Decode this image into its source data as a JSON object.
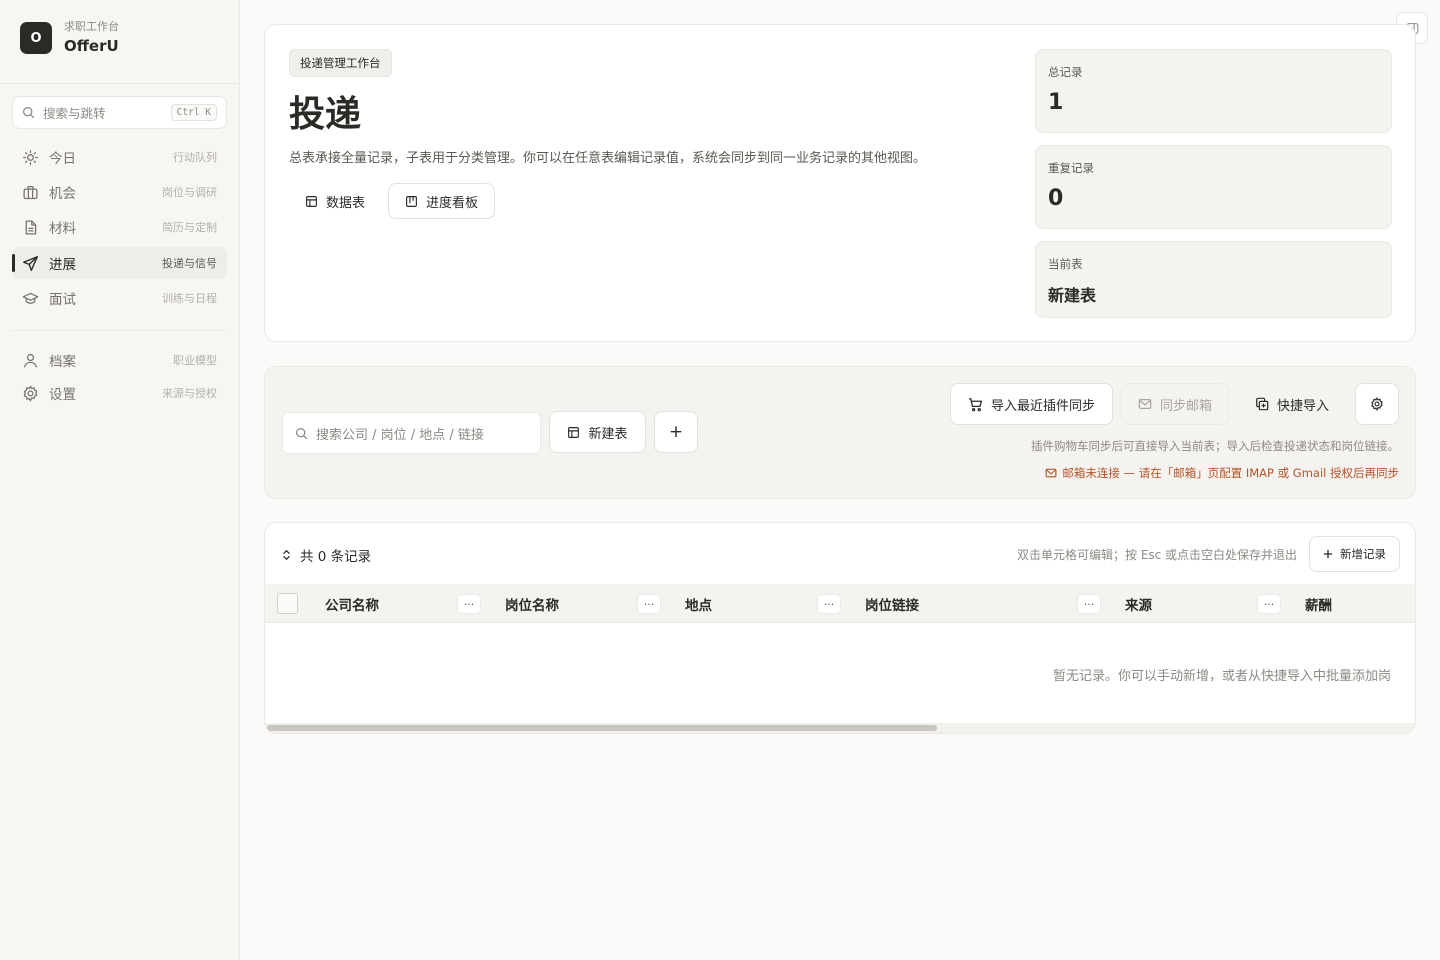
{
  "app": {
    "subtitle": "求职工作台",
    "name": "OfferU",
    "logo_letter": "O"
  },
  "sidebar": {
    "search": {
      "placeholder": "搜索与跳转",
      "shortcut": "Ctrl K"
    },
    "items": [
      {
        "label": "今日",
        "hint": "行动队列",
        "icon": "sun-icon",
        "active": false
      },
      {
        "label": "机会",
        "hint": "岗位与调研",
        "icon": "briefcase-icon",
        "active": false
      },
      {
        "label": "材料",
        "hint": "简历与定制",
        "icon": "document-icon",
        "active": false
      },
      {
        "label": "进展",
        "hint": "投递与信号",
        "icon": "send-icon",
        "active": true
      },
      {
        "label": "面试",
        "hint": "训练与日程",
        "icon": "graduation-cap-icon",
        "active": false
      }
    ],
    "bottom_items": [
      {
        "label": "档案",
        "hint": "职业模型",
        "icon": "user-icon"
      },
      {
        "label": "设置",
        "hint": "来源与授权",
        "icon": "gear-icon"
      }
    ]
  },
  "hero": {
    "badge": "投递管理工作台",
    "title": "投递",
    "description": "总表承接全量记录，子表用于分类管理。你可以在任意表编辑记录值，系统会同步到同一业务记录的其他视图。",
    "views": [
      {
        "label": "数据表",
        "icon": "table-icon"
      },
      {
        "label": "进度看板",
        "icon": "kanban-icon"
      }
    ],
    "stats": [
      {
        "label": "总记录",
        "value": "1"
      },
      {
        "label": "重复记录",
        "value": "0"
      },
      {
        "label": "当前表",
        "value": "新建表"
      }
    ]
  },
  "toolbar": {
    "search_placeholder": "搜索公司 / 岗位 / 地点 / 链接",
    "new_table_label": "新建表",
    "add_label": "+",
    "import_plugin_label": "导入最近插件同步",
    "sync_mail_label": "同步邮箱",
    "quick_import_label": "快捷导入",
    "hint": "插件购物车同步后可直接导入当前表；导入后检查投递状态和岗位链接。",
    "warning": "邮箱未连接 — 请在「邮箱」页配置 IMAP 或 Gmail 授权后再同步"
  },
  "table": {
    "count_label": "共 0 条记录",
    "edit_hint": "双击单元格可编辑；按 Esc 或点击空白处保存并退出",
    "add_record_label": "新增记录",
    "columns": [
      "公司名称",
      "岗位名称",
      "地点",
      "岗位链接",
      "来源",
      "薪酬"
    ],
    "more_label": "···",
    "empty_message": "暂无记录。你可以手动新增，或者从快捷导入中批量添加岗"
  },
  "colors": {
    "accent": "#2b2a27",
    "warning": "#b2542a",
    "background": "#fbfaf8",
    "sidebar": "#f7f6f3"
  }
}
